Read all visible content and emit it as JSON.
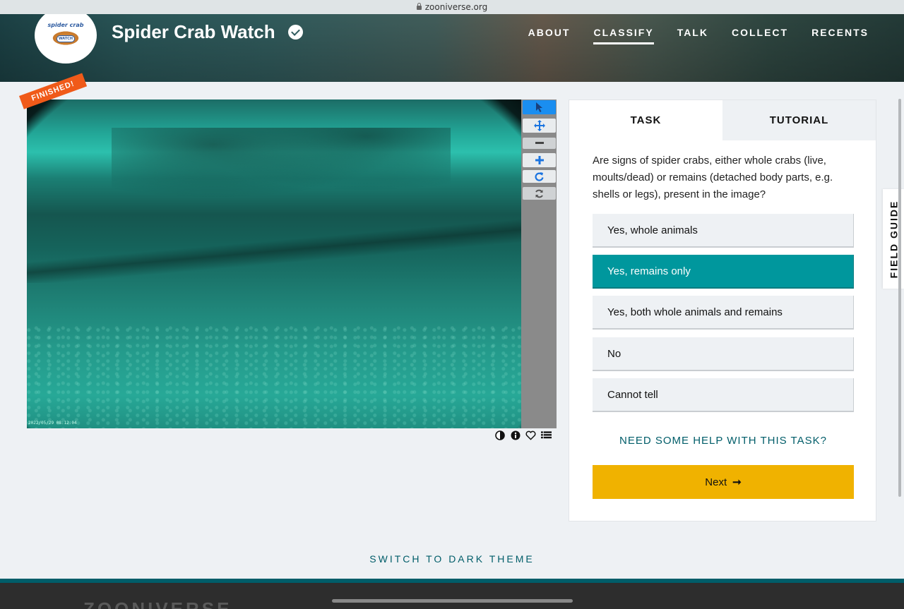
{
  "browser": {
    "url": "zooniverse.org"
  },
  "header": {
    "logo_text": "spider crab",
    "logo_badge": "WATCH",
    "project_title": "Spider Crab Watch",
    "nav": [
      {
        "label": "ABOUT",
        "active": false
      },
      {
        "label": "CLASSIFY",
        "active": true
      },
      {
        "label": "TALK",
        "active": false
      },
      {
        "label": "COLLECT",
        "active": false
      },
      {
        "label": "RECENTS",
        "active": false
      }
    ]
  },
  "viewer": {
    "ribbon": "FINISHED!",
    "timestamp": "2022/05/29 08:12:04",
    "tools": [
      "pointer-icon",
      "move-icon",
      "zoom-out-icon",
      "zoom-in-icon",
      "rotate-icon",
      "reset-icon"
    ],
    "bottom_icons": [
      "invert-icon",
      "info-icon",
      "favorite-icon",
      "collections-icon"
    ]
  },
  "task_panel": {
    "tabs": {
      "task": "TASK",
      "tutorial": "TUTORIAL"
    },
    "question": "Are signs of spider crabs, either whole crabs (live, moults/dead) or remains (detached body parts, e.g. shells or legs), present in the image?",
    "answers": [
      {
        "label": "Yes, whole animals",
        "selected": false
      },
      {
        "label": "Yes, remains only",
        "selected": true
      },
      {
        "label": "Yes, both whole animals and remains",
        "selected": false
      },
      {
        "label": "No",
        "selected": false
      },
      {
        "label": "Cannot tell",
        "selected": false
      }
    ],
    "help_link": "NEED SOME HELP WITH THIS TASK?",
    "next_label": "Next",
    "next_arrow": "➞"
  },
  "field_guide": "FIELD GUIDE",
  "switch_theme": "SWITCH TO DARK THEME",
  "footer": {
    "logo": "ZOONIVERSE"
  },
  "colors": {
    "selected_answer": "#00979d",
    "next_button": "#f0b200",
    "link": "#005d69",
    "ribbon": "#f05a19",
    "active_tool": "#1a8ef0"
  }
}
